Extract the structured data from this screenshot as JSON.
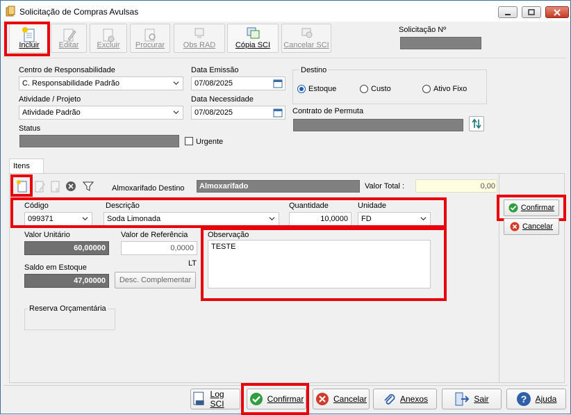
{
  "window": {
    "title": "Solicitação de Compras Avulsas"
  },
  "toolbar": {
    "incluir": "Incluir",
    "editar": "Editar",
    "excluir": "Excluir",
    "procurar": "Procurar",
    "obs_rad": "Obs RAD",
    "copia_sci": "Cópia SCI",
    "cancelar_sci": "Cancelar SCI"
  },
  "header": {
    "solicitacao_label": "Solicitação Nº",
    "solicitacao_value": ""
  },
  "form": {
    "centro_label": "Centro de Responsabilidade",
    "centro_value": "C. Responsabilidade Padrão",
    "data_emissao_label": "Data Emissão",
    "data_emissao_value": "07/08/2025",
    "destino_label": "Destino",
    "destino_options": [
      "Estoque",
      "Custo",
      "Ativo Fixo"
    ],
    "destino_selected": "Estoque",
    "atividade_label": "Atividade / Projeto",
    "atividade_value": "Atividade Padrão",
    "data_necessidade_label": "Data Necessidade",
    "data_necessidade_value": "07/08/2025",
    "contrato_label": "Contrato de Permuta",
    "status_label": "Status",
    "urgente_label": "Urgente"
  },
  "itens": {
    "tab_label": "Itens",
    "almox_label": "Almoxarifado Destino",
    "almox_value": "Almoxarifado",
    "valor_total_label": "Valor Total :",
    "valor_total_value": "0,00",
    "codigo_label": "Código",
    "codigo_value": "099371",
    "descricao_label": "Descrição",
    "descricao_value": "Soda Limonada",
    "quantidade_label": "Quantidade",
    "quantidade_value": "10,0000",
    "unidade_label": "Unidade",
    "unidade_value": "FD",
    "valor_unitario_label": "Valor Unitário",
    "valor_unitario_value": "60,00000",
    "valor_referencia_label": "Valor de Referência",
    "valor_referencia_value": "0,0000",
    "lt_label": "LT",
    "observacao_label": "Observação",
    "observacao_value": "TESTE",
    "saldo_label": "Saldo em Estoque",
    "saldo_value": "47,00000",
    "desc_complementar": "Desc. Complementar",
    "reserva_label": "Reserva Orçamentária",
    "confirmar": "Confirmar",
    "cancelar": "Cancelar"
  },
  "footer": {
    "log_sci": "Log SCI",
    "confirmar": "Confirmar",
    "cancelar": "Cancelar",
    "anexos": "Anexos",
    "sair": "Sair",
    "ajuda": "Ajuda"
  },
  "colors": {
    "highlight": "#e8000b",
    "accent": "#1a5fb4",
    "confirm_green": "#2e9e3e",
    "cancel_red": "#d23a2a"
  }
}
